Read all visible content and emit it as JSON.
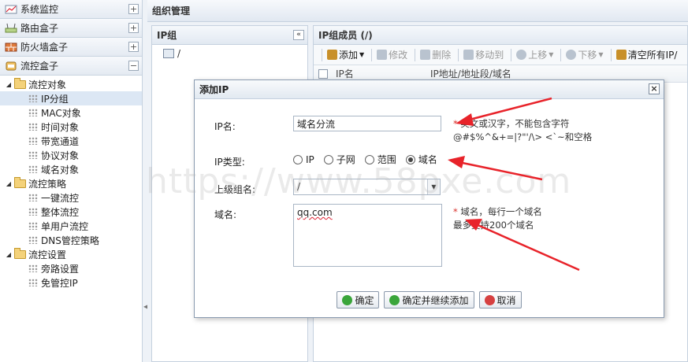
{
  "nav": {
    "sections": [
      {
        "label": "系统监控",
        "toggle": "+",
        "icon": "monitor-icon"
      },
      {
        "label": "路由盒子",
        "toggle": "+",
        "icon": "router-icon"
      },
      {
        "label": "防火墙盒子",
        "toggle": "+",
        "icon": "firewall-icon"
      },
      {
        "label": "流控盒子",
        "toggle": "−",
        "icon": "flow-control-icon"
      }
    ],
    "tree": [
      {
        "label": "流控对象",
        "type": "folder"
      },
      {
        "label": "IP分组",
        "type": "leaf",
        "selected": true
      },
      {
        "label": "MAC对象",
        "type": "leaf"
      },
      {
        "label": "时间对象",
        "type": "leaf"
      },
      {
        "label": "带宽通道",
        "type": "leaf"
      },
      {
        "label": "协议对象",
        "type": "leaf"
      },
      {
        "label": "域名对象",
        "type": "leaf"
      },
      {
        "label": "流控策略",
        "type": "folder"
      },
      {
        "label": "一键流控",
        "type": "leaf"
      },
      {
        "label": "整体流控",
        "type": "leaf"
      },
      {
        "label": "单用户流控",
        "type": "leaf"
      },
      {
        "label": "DNS管控策略",
        "type": "leaf"
      },
      {
        "label": "流控设置",
        "type": "folder"
      },
      {
        "label": "旁路设置",
        "type": "leaf"
      },
      {
        "label": "免管控IP",
        "type": "leaf"
      }
    ]
  },
  "main": {
    "title": "组织管理",
    "ip_group_panel": {
      "title": "IP组",
      "collapse": "«",
      "root": "/"
    },
    "members_panel": {
      "title": "IP组成员 (/)",
      "toolbar": [
        {
          "label": "添加",
          "enabled": true,
          "caret": true,
          "icon": "add-icon"
        },
        {
          "label": "修改",
          "enabled": false,
          "icon": "edit-icon"
        },
        {
          "label": "删除",
          "enabled": false,
          "icon": "delete-icon"
        },
        {
          "label": "移动到",
          "enabled": false,
          "icon": "move-icon"
        },
        {
          "label": "上移",
          "enabled": false,
          "caret": true,
          "icon": "up-icon"
        },
        {
          "label": "下移",
          "enabled": false,
          "caret": true,
          "icon": "down-icon"
        },
        {
          "label": "清空所有IP/",
          "enabled": true,
          "icon": "clear-icon"
        }
      ],
      "columns": [
        "IP名",
        "IP地址/地址段/域名"
      ]
    }
  },
  "dialog": {
    "title": "添加IP",
    "close": "×",
    "ip_name": {
      "label": "IP名:",
      "value": "域名分流",
      "hint_line1": "英文或汉字，不能包含字符",
      "hint_line2": "@#$%^&+=|?\"'/\\> <`~和空格",
      "required_mark": "*"
    },
    "ip_type": {
      "label": "IP类型:",
      "options": [
        "IP",
        "子网",
        "范围",
        "域名"
      ],
      "selected": "域名"
    },
    "parent_group": {
      "label": "上级组名:",
      "value": "/"
    },
    "domain": {
      "label": "域名:",
      "value": "qq.com",
      "hint_line1": "域名，每行一个域名",
      "hint_line2": "最多支持200个域名",
      "required_mark": "*"
    },
    "buttons": {
      "confirm": "确定",
      "confirm_continue": "确定并继续添加",
      "cancel": "取消"
    }
  },
  "watermark": "https://www.58pxe.com",
  "colors": {
    "arrow": "#e8232a",
    "accent": "#c8902a",
    "selected_row": "#dce7f4",
    "required": "#d9302a"
  }
}
